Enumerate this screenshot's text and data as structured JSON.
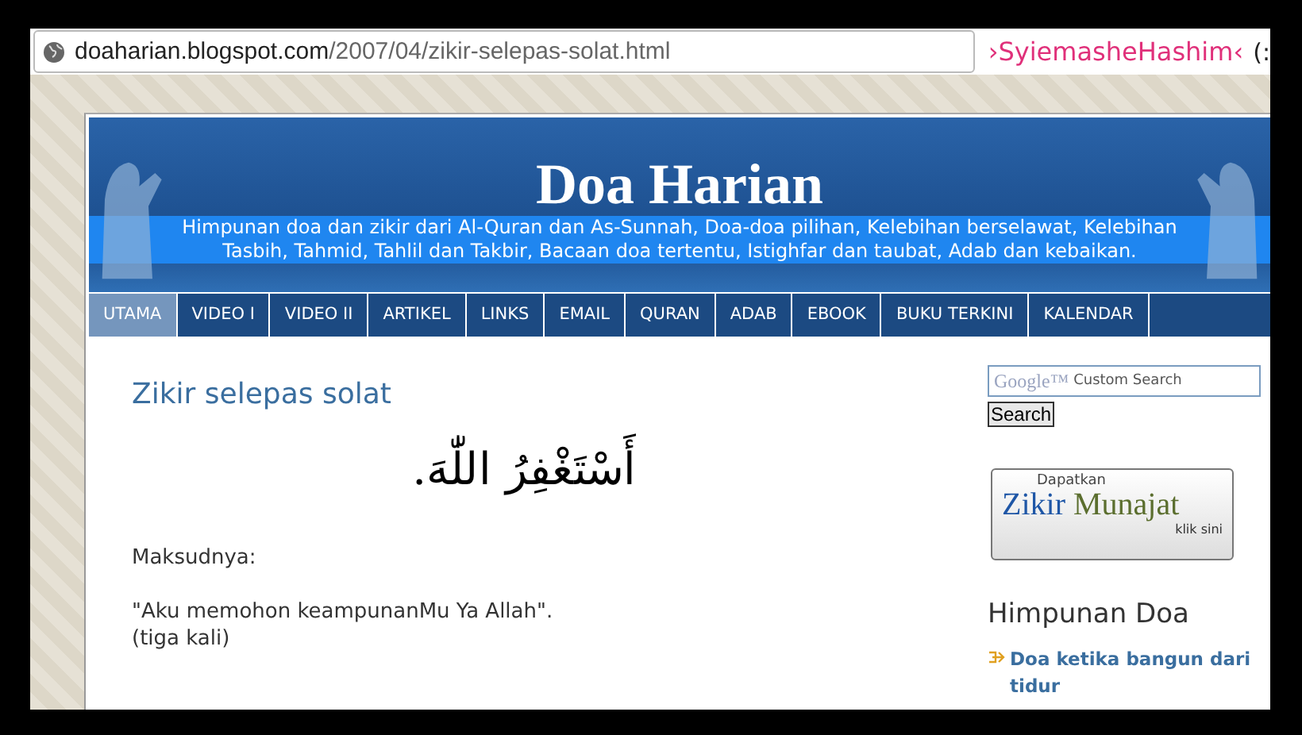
{
  "address_bar": {
    "domain": "doaharian.blogspot.com",
    "path": "/2007/04/zikir-selepas-solat.html"
  },
  "signature": {
    "name": "›SyiemasheHashim‹",
    "emoticon": "(:"
  },
  "header": {
    "title": "Doa Harian",
    "description": "Himpunan doa dan zikir dari Al-Quran dan As-Sunnah, Doa-doa pilihan, Kelebihan berselawat, Kelebihan Tasbih, Tahmid, Tahlil dan Takbir, Bacaan doa tertentu, Istighfar dan taubat, Adab dan kebaikan."
  },
  "nav": [
    {
      "label": "UTAMA",
      "selected": true
    },
    {
      "label": "VIDEO I",
      "selected": false
    },
    {
      "label": "VIDEO II",
      "selected": false
    },
    {
      "label": "ARTIKEL",
      "selected": false
    },
    {
      "label": "LINKS",
      "selected": false
    },
    {
      "label": "EMAIL",
      "selected": false
    },
    {
      "label": "QURAN",
      "selected": false
    },
    {
      "label": "ADAB",
      "selected": false
    },
    {
      "label": "EBOOK",
      "selected": false
    },
    {
      "label": "BUKU TERKINI",
      "selected": false
    },
    {
      "label": "KALENDAR",
      "selected": false
    }
  ],
  "post": {
    "title": "Zikir selepas solat",
    "arabic": "أَسْتَغْفِرُ اللّٰهَ.",
    "lines": [
      "Maksudnya:",
      "\"Aku memohon keampunanMu Ya Allah\".",
      "(tiga kali)"
    ]
  },
  "sidebar": {
    "search": {
      "brand": "Google™",
      "placeholder": "Custom Search",
      "button": "Search"
    },
    "banner": {
      "top": "Dapatkan",
      "word1": "Zikir",
      "word2": "Munajat",
      "bottom": "klik sini"
    },
    "section_title": "Himpunan Doa",
    "links": [
      "Doa ketika bangun dari tidur"
    ]
  }
}
